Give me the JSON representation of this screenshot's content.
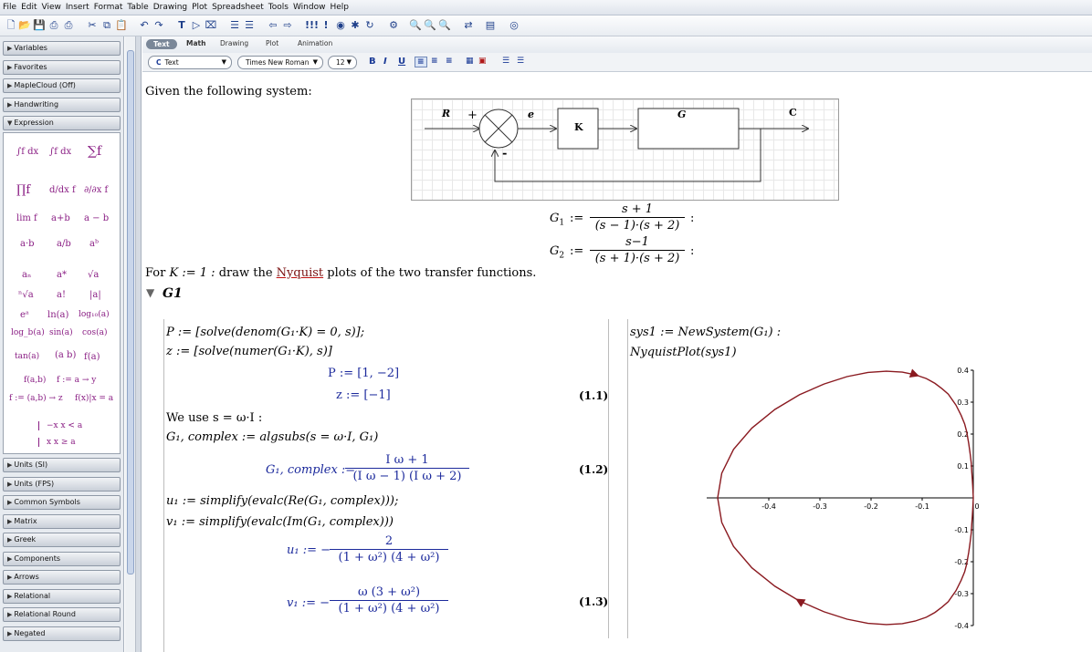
{
  "menu": [
    "File",
    "Edit",
    "View",
    "Insert",
    "Format",
    "Table",
    "Drawing",
    "Plot",
    "Spreadsheet",
    "Tools",
    "Window",
    "Help"
  ],
  "palette": {
    "sections_top": [
      "Variables",
      "Favorites",
      "MapleCloud (Off)",
      "Handwriting",
      "Expression"
    ],
    "sections_bottom": [
      "Units (SI)",
      "Units (FPS)",
      "Common Symbols",
      "Matrix",
      "Greek",
      "Components",
      "Arrows",
      "Relational",
      "Relational Round",
      "Negated"
    ],
    "expressions": {
      "r1": [
        "∫f dx",
        "∫f dx",
        "∑f"
      ],
      "r2": [
        "∏f",
        "d/dx f",
        "∂/∂x f"
      ],
      "r3": [
        "lim f",
        "a+b",
        "a − b"
      ],
      "r4": [
        "a·b",
        "a/b",
        "aᵇ"
      ],
      "r5": [
        "aₙ",
        "a*",
        "√a"
      ],
      "r6": [
        "ⁿ√a",
        "a!",
        "|a|"
      ],
      "r7": [
        "eᵃ",
        "ln(a)",
        "log₁₀(a)"
      ],
      "r8": [
        "log_b(a)",
        "sin(a)",
        "cos(a)"
      ],
      "r9": [
        "tan(a)",
        "(a b)",
        "f(a)"
      ],
      "r10": [
        "f(a,b)",
        "f := a → y"
      ],
      "r11": [
        "f := (a,b) → z",
        "f(x)|x = a"
      ],
      "r12": [
        "−x  x < a",
        "x  x ≥ a"
      ]
    }
  },
  "modes": {
    "text": "Text",
    "math": "Math",
    "drawing": "Drawing",
    "plot": "Plot",
    "animation": "Animation"
  },
  "format": {
    "style": "Text",
    "font": "Times New Roman",
    "size": "12",
    "bold": "B",
    "italic": "I",
    "underline": "U"
  },
  "doc": {
    "intro": "Given the following system:",
    "diagram": {
      "r": "R",
      "plus": "+",
      "minus": "-",
      "e": "e",
      "k": "K",
      "g": "G",
      "c": "C"
    },
    "g1": {
      "lhs": "G",
      "sub": "1",
      "assign": ":=",
      "num": "s + 1",
      "den": "(s − 1)·(s + 2)",
      "colon": ":"
    },
    "g2": {
      "lhs": "G",
      "sub": "2",
      "assign": ":=",
      "num": "s−1",
      "den": "(s + 1)·(s + 2)",
      "colon": ":"
    },
    "task_prefix": "For",
    "task_k": "K := 1 :",
    "task_mid": "draw the",
    "task_link": "Nyquist",
    "task_suffix": "plots of the two transfer functions.",
    "section": "G1",
    "left": {
      "in1": "P := [solve(denom(G₁·K) = 0, s)];",
      "in2": "z := [solve(numer(G₁·K), s)]",
      "out_p": "P := [1, −2]",
      "out_z": "z := [−1]",
      "label1": "(1.1)",
      "we_use": "We use s = ω·I :",
      "in3": "G₁, complex := algsubs(s = ω·I, G₁)",
      "out_gc_lhs": "G₁, complex :=",
      "out_gc_num": "I ω + 1",
      "out_gc_den": "(I ω − 1) (I ω + 2)",
      "label2": "(1.2)",
      "in4": "u₁ := simplify(evalc(Re(G₁, complex)));",
      "in5": "v₁ := simplify(evalc(Im(G₁, complex)))",
      "out_u_lhs": "u₁ := −",
      "out_u_num": "2",
      "out_u_den": "(1 + ω²) (4 + ω²)",
      "out_v_lhs": "v₁ := −",
      "out_v_num": "ω (3 + ω²)",
      "out_v_den": "(1 + ω²) (4 + ω²)",
      "label3": "(1.3)"
    },
    "right": {
      "in1": "sys1 := NewSystem(G₁) :",
      "in2": "NyquistPlot(sys1)"
    }
  },
  "chart_data": {
    "type": "line",
    "title": "",
    "xlabel": "",
    "ylabel": "",
    "xlim": [
      -0.5,
      0.0
    ],
    "ylim": [
      -0.4,
      0.4
    ],
    "xticks": [
      "-0.4",
      "-0.3",
      "-0.2",
      "-0.1",
      "0"
    ],
    "yticks": [
      "0.4",
      "0.3",
      "0.2",
      "0.1",
      "-0.1",
      "-0.2",
      "-0.3",
      "-0.4"
    ],
    "grid": false,
    "line_color": "#8a1a20",
    "series": [
      {
        "x": [
          -0.5,
          -0.492,
          -0.469,
          -0.433,
          -0.388,
          -0.34,
          -0.292,
          -0.247,
          -0.206,
          -0.17,
          -0.139,
          -0.114,
          -0.092,
          -0.075,
          -0.061,
          -0.049,
          -0.034,
          -0.024,
          -0.017,
          -0.013,
          -0.009,
          -0.006,
          -0.004,
          -0.003,
          -0.002,
          -0.001,
          0.0,
          -0.001,
          -0.002,
          -0.003,
          -0.004,
          -0.006,
          -0.009,
          -0.013,
          -0.017,
          -0.024,
          -0.034,
          -0.049,
          -0.061,
          -0.075,
          -0.092,
          -0.114,
          -0.139,
          -0.17,
          -0.206,
          -0.247,
          -0.292,
          -0.34,
          -0.388,
          -0.433,
          -0.469,
          -0.492,
          -0.5
        ],
        "y": [
          0.0,
          0.077,
          0.152,
          0.219,
          0.277,
          0.323,
          0.357,
          0.38,
          0.393,
          0.397,
          0.394,
          0.386,
          0.374,
          0.359,
          0.342,
          0.325,
          0.291,
          0.259,
          0.232,
          0.208,
          0.17,
          0.137,
          0.108,
          0.082,
          0.058,
          0.034,
          0.0,
          -0.034,
          -0.058,
          -0.082,
          -0.108,
          -0.137,
          -0.17,
          -0.208,
          -0.232,
          -0.259,
          -0.291,
          -0.325,
          -0.342,
          -0.359,
          -0.374,
          -0.386,
          -0.394,
          -0.397,
          -0.393,
          -0.38,
          -0.357,
          -0.323,
          -0.277,
          -0.219,
          -0.152,
          -0.077,
          0.0
        ]
      }
    ]
  }
}
